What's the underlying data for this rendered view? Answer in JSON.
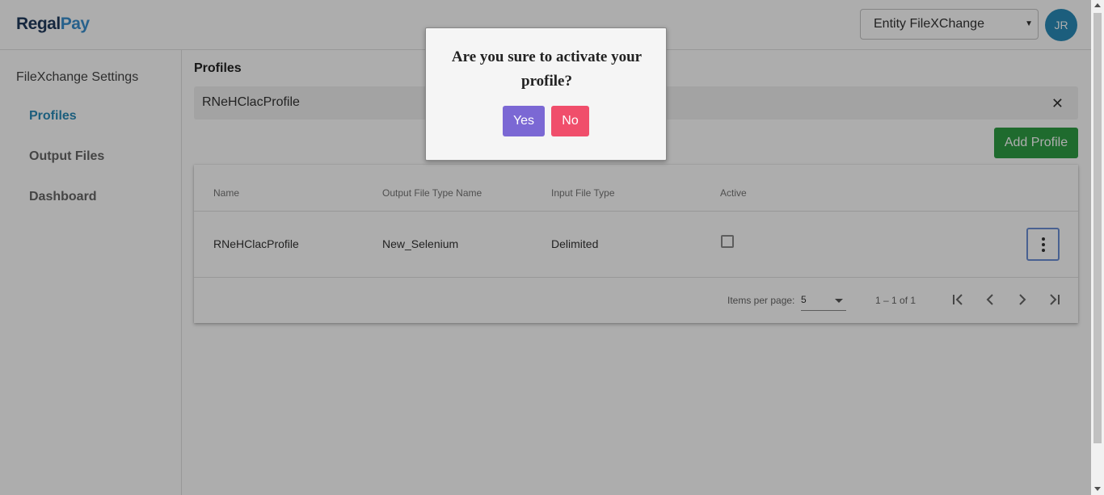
{
  "header": {
    "logo_part1": "Regal",
    "logo_part2": "Pay",
    "entity_select": "Entity FileXChange",
    "avatar_initials": "JR"
  },
  "sidebar": {
    "title": "FileXchange Settings",
    "items": [
      {
        "label": "Profiles",
        "active": true
      },
      {
        "label": "Output Files",
        "active": false
      },
      {
        "label": "Dashboard",
        "active": false
      }
    ]
  },
  "main": {
    "title": "Profiles",
    "search_value": "RNeHClacProfile",
    "clear_icon": "close-icon",
    "add_button": "Add Profile",
    "table": {
      "columns": [
        "Name",
        "Output File Type Name",
        "Input File Type",
        "Active"
      ],
      "rows": [
        {
          "name": "RNeHClacProfile",
          "output_type": "New_Selenium",
          "input_type": "Delimited",
          "active": false
        }
      ]
    },
    "paginator": {
      "items_per_page_label": "Items per page:",
      "items_per_page": "5",
      "range": "1 – 1 of 1"
    }
  },
  "dialog": {
    "message": "Are you sure to activate your profile?",
    "yes": "Yes",
    "no": "No"
  },
  "colors": {
    "accent": "#2a8bb8",
    "add_button": "#2f9e44",
    "yes_button": "#7b68d4",
    "no_button": "#f04e6b"
  }
}
